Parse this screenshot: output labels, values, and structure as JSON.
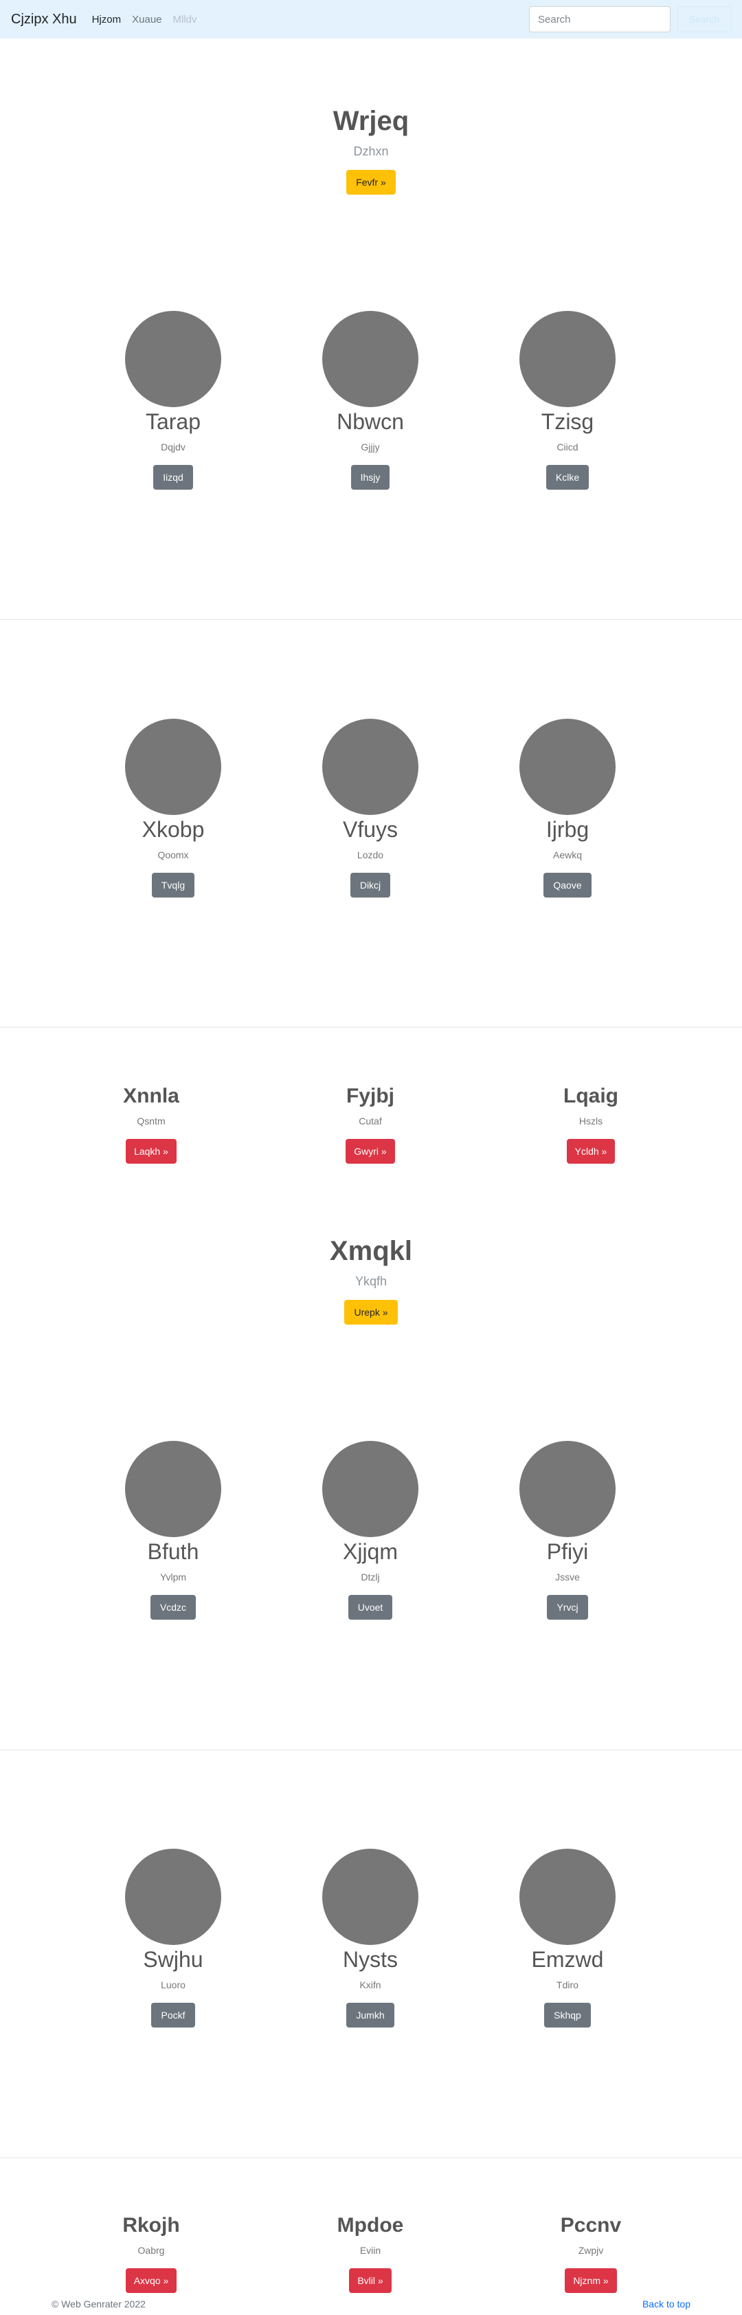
{
  "navbar": {
    "brand": "Cjzipx Xhu",
    "links": [
      "Hjzom",
      "Xuaue",
      "Mlldv"
    ],
    "search_placeholder": "Search",
    "search_button": "Search"
  },
  "heroes": [
    {
      "title": "Wrjeq",
      "subtitle": "Dzhxn",
      "button": "Fevfr »"
    },
    {
      "title": "Xmqkl",
      "subtitle": "Ykqfh",
      "button": "Urepk »"
    }
  ],
  "circle_rows": [
    [
      {
        "name": "Tarap",
        "sub": "Dqjdv",
        "button": "Iizqd"
      },
      {
        "name": "Nbwcn",
        "sub": "Gjjjy",
        "button": "Ihsjy"
      },
      {
        "name": "Tzisg",
        "sub": "Ciicd",
        "button": "Kclke"
      }
    ],
    [
      {
        "name": "Xkobp",
        "sub": "Qoomx",
        "button": "Tvqlg"
      },
      {
        "name": "Vfuys",
        "sub": "Lozdo",
        "button": "Dikcj"
      },
      {
        "name": "Ijrbg",
        "sub": "Aewkq",
        "button": "Qaove"
      }
    ],
    [
      {
        "name": "Bfuth",
        "sub": "Yvlpm",
        "button": "Vcdzc"
      },
      {
        "name": "Xjjqm",
        "sub": "Dtzlj",
        "button": "Uvoet"
      },
      {
        "name": "Pfiyi",
        "sub": "Jssve",
        "button": "Yrvcj"
      }
    ],
    [
      {
        "name": "Swjhu",
        "sub": "Luoro",
        "button": "Pockf"
      },
      {
        "name": "Nysts",
        "sub": "Kxifn",
        "button": "Jumkh"
      },
      {
        "name": "Emzwd",
        "sub": "Tdiro",
        "button": "Skhqp"
      }
    ]
  ],
  "text_rows": [
    [
      {
        "title": "Xnnla",
        "sub": "Qsntm",
        "button": "Laqkh »"
      },
      {
        "title": "Fyjbj",
        "sub": "Cutaf",
        "button": "Gwyri »"
      },
      {
        "title": "Lqaig",
        "sub": "Hszls",
        "button": "Ycldh »"
      }
    ],
    [
      {
        "title": "Rkojh",
        "sub": "Oabrg",
        "button": "Axvqo »"
      },
      {
        "title": "Mpdoe",
        "sub": "Eviin",
        "button": "Bvlil »"
      },
      {
        "title": "Pccnv",
        "sub": "Zwpjv",
        "button": "Njznm »"
      }
    ]
  ],
  "footer": {
    "copyright": "© Web Genrater 2022",
    "back_to_top": "Back to top"
  }
}
